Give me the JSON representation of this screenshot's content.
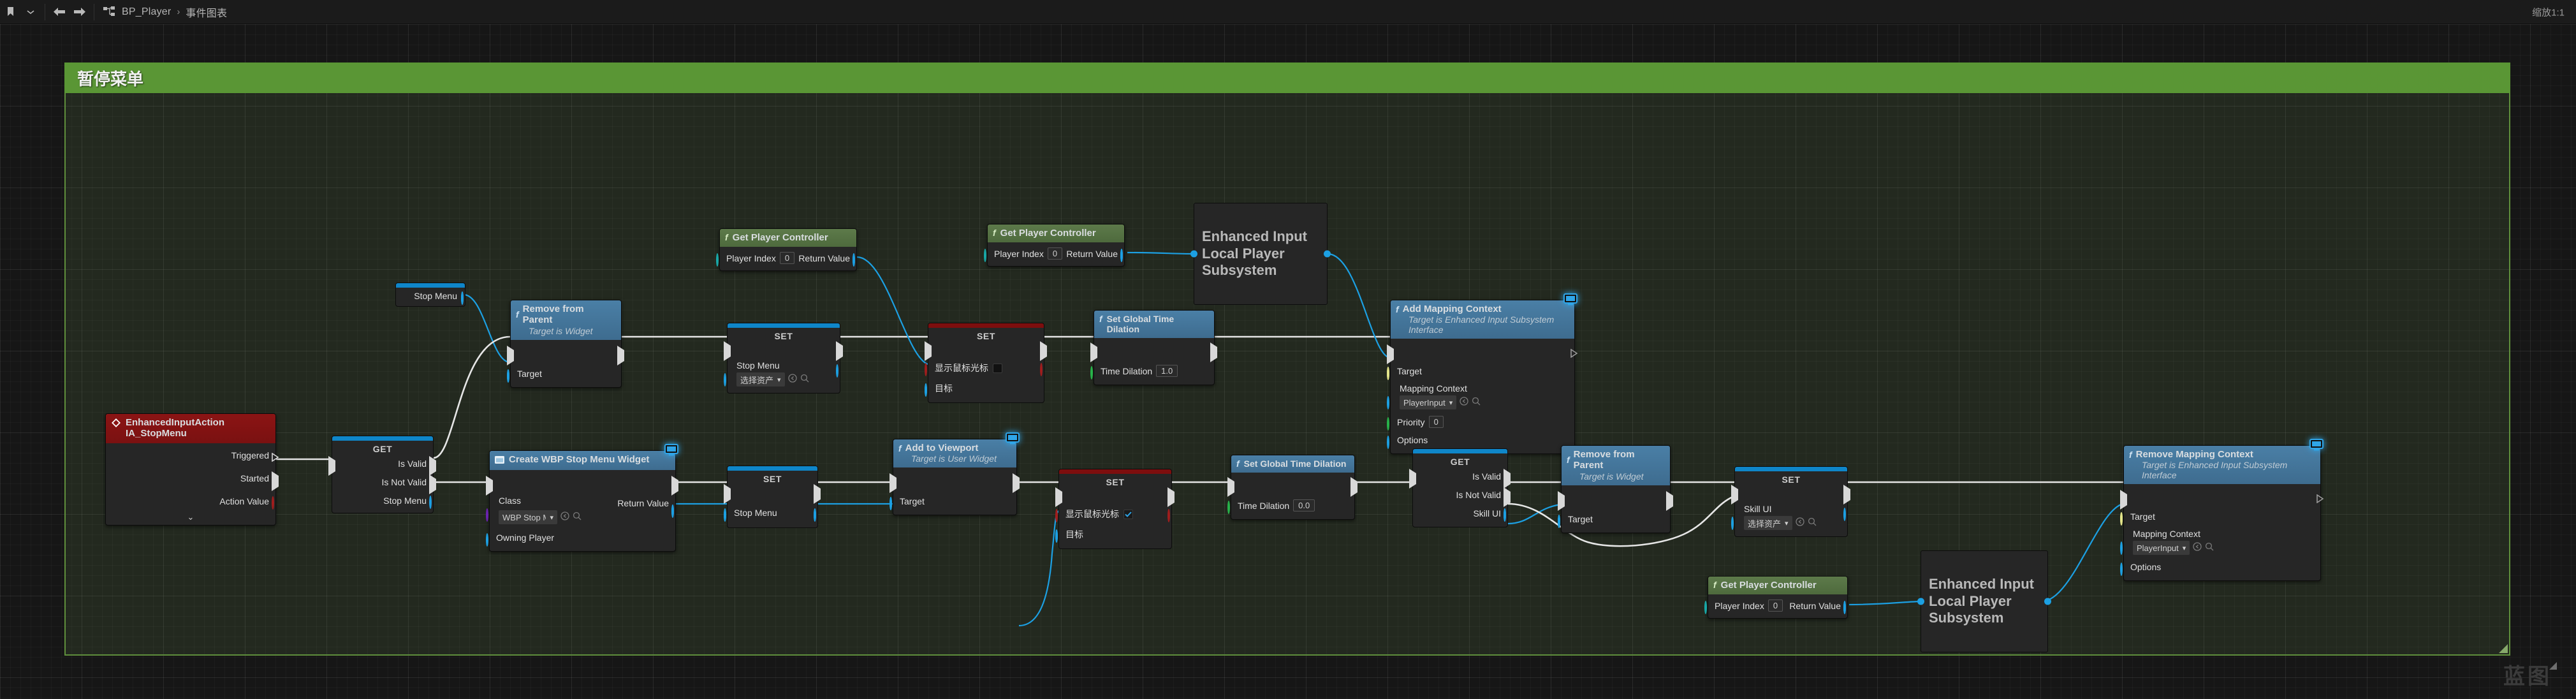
{
  "toolbar": {
    "bookmark_icon": "bookmark-icon",
    "dropdown_icon": "chevron-down-icon",
    "back_icon": "arrow-left-icon",
    "forward_icon": "arrow-right-icon",
    "graph_icon": "blueprint-graph-icon",
    "breadcrumb_root": "BP_Player",
    "breadcrumb_sep": "›",
    "breadcrumb_current": "事件图表",
    "zoom_label": "缩放1:1"
  },
  "comment": {
    "title": "暂停菜单",
    "color": "#5a9635"
  },
  "watermark": "蓝图",
  "nodes": {
    "event_stopmenu": {
      "title": "EnhancedInputAction IA_StopMenu",
      "pins": [
        "Triggered",
        "Started",
        "Action Value"
      ],
      "expander": "⌄"
    },
    "get_stopmenu_pure": {
      "var": "Stop Menu"
    },
    "isvalid_stopmenu": {
      "label": "GET",
      "out_valid": "Is Valid",
      "out_invalid": "Is Not Valid",
      "var": "Stop Menu"
    },
    "remove_from_parent_top": {
      "title": "Remove from Parent",
      "subtitle": "Target is Widget",
      "target": "Target"
    },
    "set_stopmenu_top": {
      "label": "SET",
      "pin": "Stop Menu",
      "combo": "选择资产"
    },
    "get_player_controller_1": {
      "title": "Get Player Controller",
      "player_index_label": "Player Index",
      "player_index_value": "0",
      "return_label": "Return Value"
    },
    "get_player_controller_2": {
      "title": "Get Player Controller",
      "player_index_label": "Player Index",
      "player_index_value": "0",
      "return_label": "Return Value"
    },
    "get_player_controller_3": {
      "title": "Get Player Controller",
      "player_index_label": "Player Index",
      "player_index_value": "0",
      "return_label": "Return Value"
    },
    "set_show_cursor_top": {
      "label": "SET",
      "pin": "显示鼠标光标",
      "checked": false,
      "target": "目标"
    },
    "set_show_cursor_bottom": {
      "label": "SET",
      "pin": "显示鼠标光标",
      "checked": true,
      "target": "目标"
    },
    "set_time_dilation_1": {
      "title": "Set Global Time Dilation",
      "pin": "Time Dilation",
      "value": "1.0"
    },
    "set_time_dilation_0": {
      "title": "Set Global Time Dilation",
      "pin": "Time Dilation",
      "value": "0.0"
    },
    "subsystem_top": {
      "text": "Enhanced Input Local Player Subsystem"
    },
    "subsystem_bottom": {
      "text": "Enhanced Input Local Player Subsystem"
    },
    "add_mapping_context": {
      "title": "Add Mapping Context",
      "subtitle": "Target is Enhanced Input Subsystem Interface",
      "target": "Target",
      "mapping_label": "Mapping Context",
      "mapping_value": "PlayerInput",
      "priority_label": "Priority",
      "priority_value": "0",
      "options": "Options"
    },
    "remove_mapping_context": {
      "title": "Remove Mapping Context",
      "subtitle": "Target is Enhanced Input Subsystem Interface",
      "target": "Target",
      "mapping_label": "Mapping Context",
      "mapping_value": "PlayerInput",
      "options": "Options"
    },
    "create_widget": {
      "title": "Create WBP Stop Menu Widget",
      "class_label": "Class",
      "class_value": "WBP Stop Menu",
      "owning_player": "Owning Player",
      "return_label": "Return Value"
    },
    "set_stopmenu_bottom": {
      "label": "SET",
      "pin": "Stop Menu"
    },
    "add_to_viewport": {
      "title": "Add to Viewport",
      "subtitle": "Target is User Widget",
      "target": "Target"
    },
    "isvalid_skillui": {
      "label": "GET",
      "out_valid": "Is Valid",
      "out_invalid": "Is Not Valid",
      "var": "Skill UI"
    },
    "remove_from_parent_bottom": {
      "title": "Remove from Parent",
      "subtitle": "Target is Widget",
      "target": "Target"
    },
    "set_skillui": {
      "label": "SET",
      "pin": "Skill UI",
      "combo": "选择资产"
    }
  }
}
